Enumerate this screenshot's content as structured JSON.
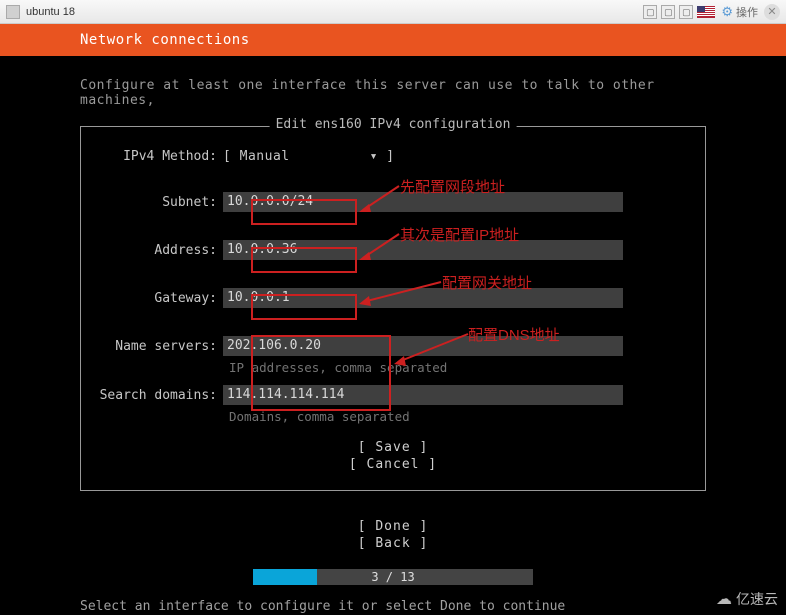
{
  "vm": {
    "title": "ubuntu 18",
    "op_label": "操作"
  },
  "header": {
    "title": "Network connections"
  },
  "intro": "Configure at least one interface this server can use to talk to other machines,",
  "dialog": {
    "title": "Edit ens160 IPv4 configuration",
    "method_label": "IPv4 Method:",
    "method_value": "[ Manual",
    "method_close": "]",
    "fields": {
      "subnet": {
        "label": "Subnet:",
        "value": "10.0.0.0/24"
      },
      "address": {
        "label": "Address:",
        "value": "10.0.0.36"
      },
      "gateway": {
        "label": "Gateway:",
        "value": "10.0.0.1"
      },
      "nameservers": {
        "label": "Name servers:",
        "value": "202.106.0.20",
        "hint": "IP addresses, comma separated"
      },
      "search": {
        "label": "Search domains:",
        "value": "114.114.114.114",
        "hint": "Domains, comma separated"
      }
    },
    "save": "[ Save      ]",
    "cancel": "[ Cancel    ]"
  },
  "bottom": {
    "done": "[ Done      ]",
    "back": "[ Back      ]"
  },
  "progress": {
    "text": "3 / 13"
  },
  "footer": "Select an interface to configure it or select Done to continue",
  "annotations": {
    "a1": "先配置网段地址",
    "a2": "其次是配置IP地址",
    "a3": "配置网关地址",
    "a4": "配置DNS地址"
  },
  "watermark": "亿速云"
}
